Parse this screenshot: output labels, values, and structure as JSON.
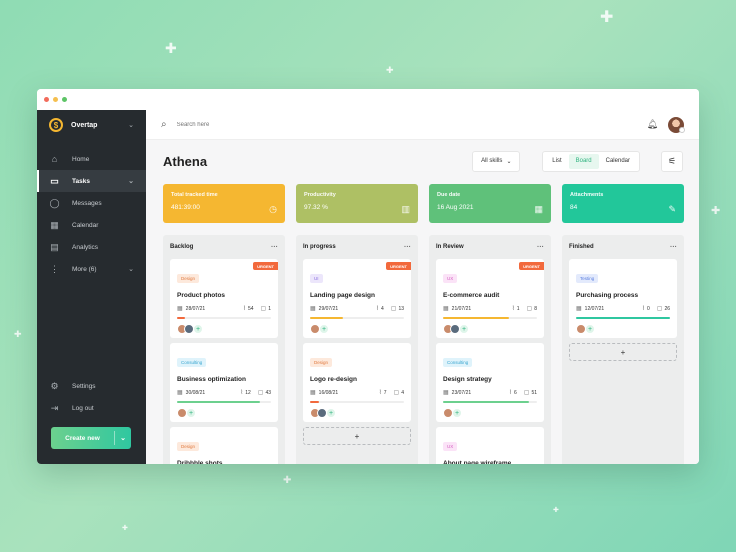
{
  "colors": {
    "sidebar": "#262b2f",
    "accent": "#2fb37f",
    "stat_tracked": "#f5b731",
    "stat_productivity": "#aec064",
    "stat_due": "#5fc17a",
    "stat_attachments": "#22c79a",
    "urgent": "#f2693c"
  },
  "sidebar": {
    "workspace": "Overtap",
    "items": [
      {
        "icon": "home-icon",
        "glyph": "⌂",
        "label": "Home"
      },
      {
        "icon": "folder-icon",
        "glyph": "▭",
        "label": "Tasks"
      },
      {
        "icon": "chat-icon",
        "glyph": "◯",
        "label": "Messages"
      },
      {
        "icon": "calendar-icon",
        "glyph": "▦",
        "label": "Calendar"
      },
      {
        "icon": "analytics-icon",
        "glyph": "▤",
        "label": "Analytics"
      },
      {
        "icon": "more-icon",
        "glyph": "⋮",
        "label": "More (6)"
      }
    ],
    "bottom": [
      {
        "icon": "gear-icon",
        "glyph": "⚙",
        "label": "Settings"
      },
      {
        "icon": "logout-icon",
        "glyph": "⇥",
        "label": "Log out"
      }
    ],
    "create_label": "Create new"
  },
  "topbar": {
    "search_placeholder": "Search here"
  },
  "header": {
    "title": "Athena",
    "skills_label": "All skills",
    "views": [
      "List",
      "Board",
      "Calendar"
    ],
    "active_view": "Board"
  },
  "stats": [
    {
      "label": "Total tracked time",
      "value": "481:39:00",
      "icon": "clock-icon",
      "glyph": "◷"
    },
    {
      "label": "Productivity",
      "value": "97.32 %",
      "icon": "chart-icon",
      "glyph": "▥"
    },
    {
      "label": "Due date",
      "value": "16 Aug 2021",
      "icon": "calendar-icon",
      "glyph": "▦"
    },
    {
      "label": "Attachments",
      "value": "84",
      "icon": "paperclip-icon",
      "glyph": "✎"
    }
  ],
  "board": {
    "urgent_label": "URGENT",
    "add_label": "+",
    "columns": [
      {
        "title": "Backlog",
        "cards": [
          {
            "tag": "Design",
            "tag_bg": "#fde9dc",
            "tag_fg": "#e07a3f",
            "urgent": true,
            "title": "Product photos",
            "date": "28/07/21",
            "attachments": "54",
            "comments": "1",
            "progress": 0.08,
            "progress_color": "#f2693c",
            "people": 2
          },
          {
            "tag": "Consulting",
            "tag_bg": "#dff3fb",
            "tag_fg": "#3aa6d0",
            "urgent": false,
            "title": "Business optimization",
            "date": "30/08/21",
            "attachments": "12",
            "comments": "43",
            "progress": 0.88,
            "progress_color": "#6cd08e",
            "people": 1
          },
          {
            "tag": "Design",
            "tag_bg": "#fde9dc",
            "tag_fg": "#e07a3f",
            "urgent": false,
            "title": "Dribbble shots",
            "date": "",
            "attachments": "",
            "comments": "",
            "progress": null,
            "progress_color": "#eeeeee",
            "people": 0
          }
        ],
        "has_add": false
      },
      {
        "title": "In progress",
        "cards": [
          {
            "tag": "UI",
            "tag_bg": "#ece6fb",
            "tag_fg": "#8b6fe0",
            "urgent": true,
            "title": "Landing page design",
            "date": "29/07/21",
            "attachments": "4",
            "comments": "13",
            "progress": 0.35,
            "progress_color": "#f5b731",
            "people": 1
          },
          {
            "tag": "Design",
            "tag_bg": "#fde9dc",
            "tag_fg": "#e07a3f",
            "urgent": false,
            "title": "Logo re-design",
            "date": "16/08/21",
            "attachments": "7",
            "comments": "4",
            "progress": 0.1,
            "progress_color": "#f2693c",
            "people": 2
          }
        ],
        "has_add": true
      },
      {
        "title": "In Review",
        "cards": [
          {
            "tag": "UX",
            "tag_bg": "#fbe3f7",
            "tag_fg": "#d461c2",
            "urgent": true,
            "title": "E-commerce audit",
            "date": "21/07/21",
            "attachments": "1",
            "comments": "8",
            "progress": 0.7,
            "progress_color": "#f5b731",
            "people": 2
          },
          {
            "tag": "Consulting",
            "tag_bg": "#dff3fb",
            "tag_fg": "#3aa6d0",
            "urgent": false,
            "title": "Design strategy",
            "date": "23/07/21",
            "attachments": "6",
            "comments": "51",
            "progress": 0.92,
            "progress_color": "#6cd08e",
            "people": 1
          },
          {
            "tag": "UX",
            "tag_bg": "#fbe3f7",
            "tag_fg": "#d461c2",
            "urgent": false,
            "title": "About page wireframe",
            "date": "",
            "attachments": "",
            "comments": "",
            "progress": null,
            "progress_color": "#eeeeee",
            "people": 0
          }
        ],
        "has_add": false
      },
      {
        "title": "Finished",
        "cards": [
          {
            "tag": "Testing",
            "tag_bg": "#e3eafc",
            "tag_fg": "#5b7fe0",
            "urgent": false,
            "title": "Purchasing process",
            "date": "12/07/21",
            "attachments": "0",
            "comments": "26",
            "progress": 1.0,
            "progress_color": "#2fc7a0",
            "people": 1
          }
        ],
        "has_add": true
      }
    ]
  }
}
